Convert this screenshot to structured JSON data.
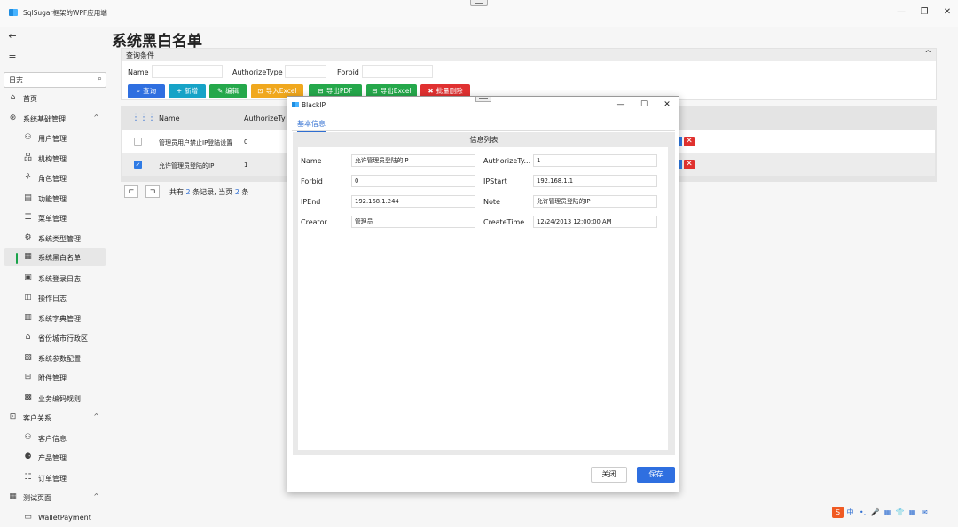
{
  "window": {
    "title": "SqlSugar框架的WPF应用端",
    "minimize": "—",
    "maximize": "❐",
    "close": "✕"
  },
  "sidebar": {
    "back": "←",
    "menu": "≡",
    "search": {
      "value": "日志",
      "icon": "⌕"
    },
    "items": [
      {
        "label": "首页",
        "icon": "⌂",
        "level": 0,
        "chevron": ""
      },
      {
        "label": "系统基础管理",
        "icon": "⊛",
        "level": 0,
        "chevron": "^"
      },
      {
        "label": "用户管理",
        "icon": "⚇",
        "level": 1
      },
      {
        "label": "机构管理",
        "icon": "品",
        "level": 1
      },
      {
        "label": "角色管理",
        "icon": "⚘",
        "level": 1
      },
      {
        "label": "功能管理",
        "icon": "▤",
        "level": 1
      },
      {
        "label": "菜单管理",
        "icon": "☰",
        "level": 1
      },
      {
        "label": "系统类型管理",
        "icon": "⚙",
        "level": 1
      },
      {
        "label": "系统黑白名单",
        "icon": "▦",
        "level": 1,
        "active": true
      },
      {
        "label": "系统登录日志",
        "icon": "▣",
        "level": 1
      },
      {
        "label": "操作日志",
        "icon": "◫",
        "level": 1
      },
      {
        "label": "系统字典管理",
        "icon": "▥",
        "level": 1
      },
      {
        "label": "省份城市行政区",
        "icon": "⌂",
        "level": 1
      },
      {
        "label": "系统参数配置",
        "icon": "▧",
        "level": 1
      },
      {
        "label": "附件管理",
        "icon": "⊟",
        "level": 1
      },
      {
        "label": "业务编码规则",
        "icon": "▩",
        "level": 1
      },
      {
        "label": "客户关系",
        "icon": "⊡",
        "level": 0,
        "chevron": "^"
      },
      {
        "label": "客户信息",
        "icon": "⚇",
        "level": 1
      },
      {
        "label": "产品管理",
        "icon": "⚈",
        "level": 1
      },
      {
        "label": "订单管理",
        "icon": "☷",
        "level": 1
      },
      {
        "label": "测试页面",
        "icon": "▦",
        "level": 0,
        "chevron": "^"
      },
      {
        "label": "WalletPayment",
        "icon": "▭",
        "level": 1
      }
    ]
  },
  "page": {
    "title": "系统黑白名单"
  },
  "query": {
    "header": "查询条件",
    "collapse": "^",
    "fields": [
      {
        "label": "Name",
        "value": ""
      },
      {
        "label": "AuthorizeType",
        "value": ""
      },
      {
        "label": "Forbid",
        "value": ""
      }
    ],
    "buttons": [
      {
        "label": "查询",
        "icon": "⌕",
        "color": "#2f6fe0"
      },
      {
        "label": "新增",
        "icon": "+",
        "color": "#17a3c7"
      },
      {
        "label": "编辑",
        "icon": "✎",
        "color": "#25a84b"
      },
      {
        "label": "导入Excel",
        "icon": "⊡",
        "color": "#f0a81e"
      },
      {
        "label": "导出PDF",
        "icon": "⊟",
        "color": "#25a84b"
      },
      {
        "label": "导出Excel",
        "icon": "⊟",
        "color": "#25a84b"
      },
      {
        "label": "批量删除",
        "icon": "✖",
        "color": "#e03131"
      }
    ]
  },
  "grid": {
    "columns": [
      "Name",
      "AuthorizeTy"
    ],
    "rows": [
      {
        "checked": false,
        "name": "管理员用户禁止IP登陆设置",
        "authorize": "0"
      },
      {
        "checked": true,
        "name": "允许管理员登陆的IP",
        "authorize": "1"
      }
    ],
    "delete_icon": "✕",
    "grid_icon": "⋮⋮⋮"
  },
  "pager": {
    "prefix": "共有",
    "total": "2",
    "mid": "条记录, 当页",
    "page_count": "2",
    "suffix": "条",
    "first_icon": "⊏",
    "last_icon": "⊐"
  },
  "dialog": {
    "title": "BlackIP",
    "min": "—",
    "max": "☐",
    "close": "✕",
    "tab": "基本信息",
    "section": "信息列表",
    "fields": [
      {
        "label": "Name",
        "value": "允许管理员登陆的IP"
      },
      {
        "label": "AuthorizeTy...",
        "value": "1"
      },
      {
        "label": "Forbid",
        "value": "0"
      },
      {
        "label": "IPStart",
        "value": "192.168.1.1"
      },
      {
        "label": "IPEnd",
        "value": "192.168.1.244"
      },
      {
        "label": "Note",
        "value": "允许管理员登陆的IP"
      },
      {
        "label": "Creator",
        "value": "管理员"
      },
      {
        "label": "CreateTime",
        "value": "12/24/2013 12:00:00 AM"
      }
    ],
    "close_label": "关闭",
    "save_label": "保存"
  },
  "ime": {
    "items": [
      "S",
      "中",
      "•,",
      "🎤",
      "▦",
      "👕",
      "▦",
      "✉"
    ]
  }
}
